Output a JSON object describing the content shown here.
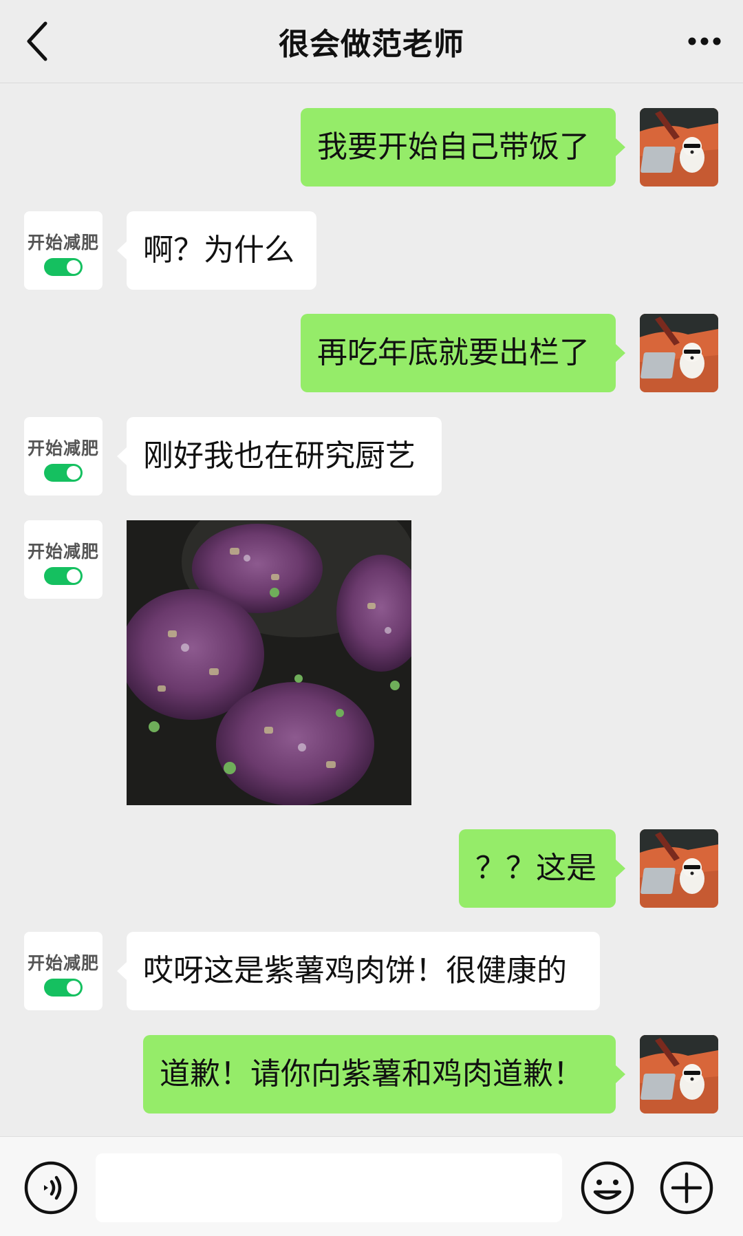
{
  "header": {
    "title": "很会做范老师",
    "back_icon": "chevron-left-icon",
    "more_icon": "more-dots-icon"
  },
  "contact": {
    "avatar_text": "开始减肥"
  },
  "messages": [
    {
      "side": "out",
      "text": "我要开始自己带饭了"
    },
    {
      "side": "in",
      "text": "啊？为什么"
    },
    {
      "side": "out",
      "text": "再吃年底就要出栏了"
    },
    {
      "side": "in",
      "text": "刚好我也在研究厨艺"
    },
    {
      "side": "in",
      "type": "image",
      "alt": "purple sweet potato chicken patties in pan"
    },
    {
      "side": "out",
      "text": "？？这是"
    },
    {
      "side": "in",
      "text": "哎呀这是紫薯鸡肉饼！很健康的"
    },
    {
      "side": "out",
      "text": "道歉！请你向紫薯和鸡肉道歉！"
    }
  ],
  "input": {
    "value": "",
    "voice_icon": "voice-icon",
    "emoji_icon": "emoji-icon",
    "plus_icon": "plus-icon"
  },
  "colors": {
    "background": "#ededed",
    "outgoing_bubble": "#95ec69",
    "incoming_bubble": "#ffffff",
    "toggle_on": "#15c060"
  }
}
